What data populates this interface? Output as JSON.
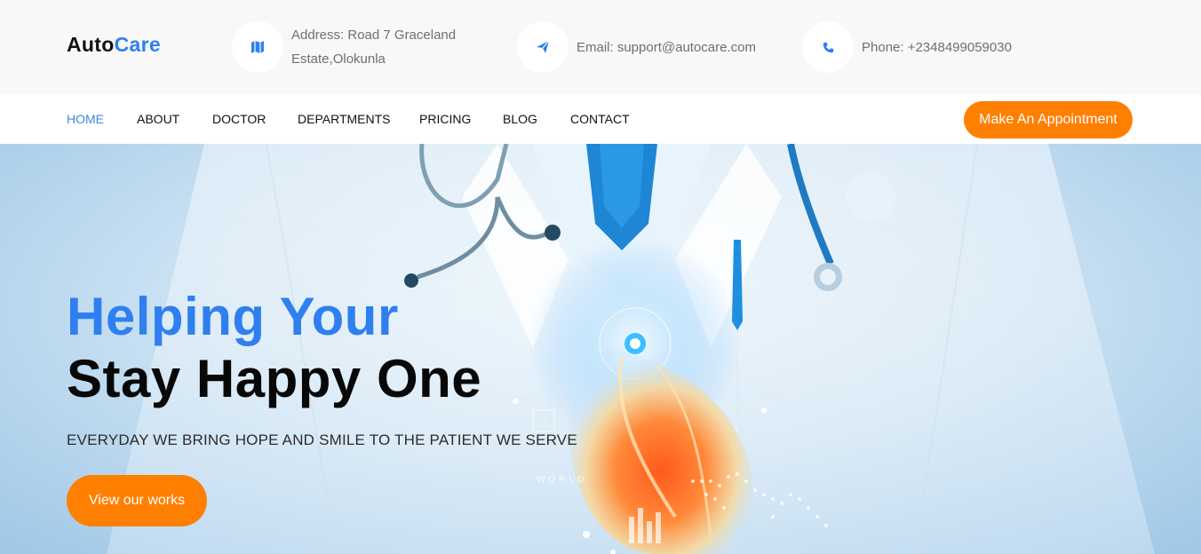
{
  "brand": {
    "part1": "Auto",
    "part2": "Care"
  },
  "contact": {
    "address_line1": "Address: Road 7 Graceland",
    "address_line2": "Estate,Olokunla",
    "email": "Email: support@autocare.com",
    "phone": "Phone: +2348499059030"
  },
  "nav": {
    "items": [
      "HOME",
      "ABOUT",
      "DOCTOR",
      "DEPARTMENTS",
      "PRICING",
      "BLOG",
      "CONTACT"
    ],
    "active": "HOME",
    "cta_label": "Make An Appointment"
  },
  "hero": {
    "title_line1": "Helping Your",
    "title_line2": "Stay Happy One",
    "subtitle": "EVERYDAY WE BRING HOPE AND SMILE TO THE PATIENT WE SERVE",
    "button_label": "View our works",
    "hud_label": "WORLD"
  },
  "colors": {
    "accent": "#2f7ff0",
    "cta": "#ff7f00",
    "topbar_bg": "#f8f8f8"
  },
  "icons": {
    "address": "map-icon",
    "email": "paper-plane-icon",
    "phone": "phone-icon"
  }
}
